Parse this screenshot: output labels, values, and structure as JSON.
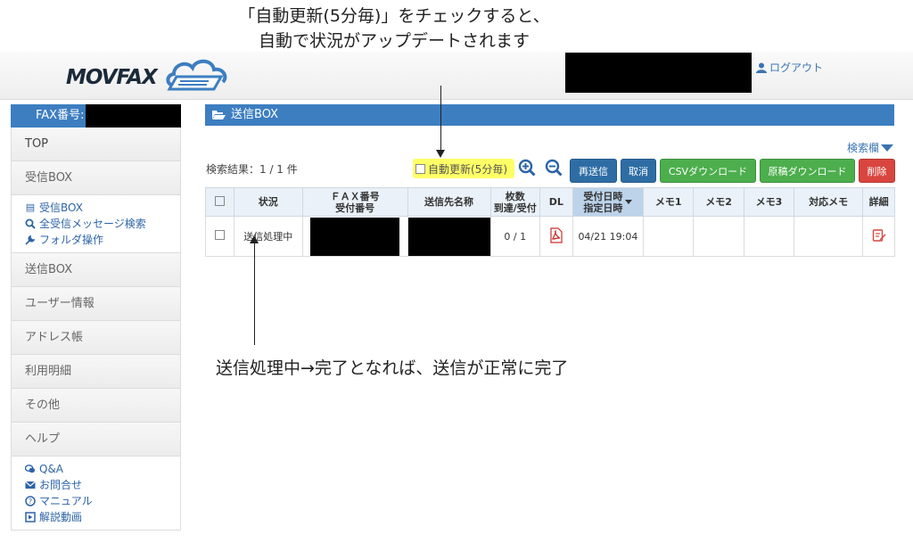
{
  "annotations": {
    "top_line1": "「自動更新(5分毎)」をチェックすると、",
    "top_line2": "自動で状況がアップデートされます",
    "mid": "送信処理中→完了となれば、送信が正常に完了"
  },
  "header": {
    "logo_text": "MOVFAX",
    "logout": "ログアウト"
  },
  "sidebar": {
    "fax_label": "FAX番号:",
    "items": [
      {
        "label": "TOP"
      },
      {
        "label": "受信BOX"
      },
      {
        "label": "送信BOX"
      },
      {
        "label": "ユーザー情報"
      },
      {
        "label": "アドレス帳"
      },
      {
        "label": "利用明細"
      },
      {
        "label": "その他"
      },
      {
        "label": "ヘルプ"
      }
    ],
    "inbox_sub": [
      {
        "label": "受信BOX",
        "icon": "inbox-icon"
      },
      {
        "label": "全受信メッセージ検索",
        "icon": "search-icon"
      },
      {
        "label": "フォルダ操作",
        "icon": "wrench-icon"
      }
    ],
    "help_sub": [
      {
        "label": "Q&A",
        "icon": "chat-icon"
      },
      {
        "label": "お問合せ",
        "icon": "envelope-icon"
      },
      {
        "label": "マニュアル",
        "icon": "question-icon"
      },
      {
        "label": "解説動画",
        "icon": "video-icon"
      }
    ]
  },
  "main": {
    "title": "送信BOX",
    "search_toggle": "検索欄",
    "result_count": "検索結果：1 / 1 件",
    "autorefresh_label": "自動更新(5分毎)",
    "buttons": {
      "resend": "再送信",
      "cancel": "取消",
      "csv": "CSVダウンロード",
      "original": "原稿ダウンロード",
      "delete": "削除"
    },
    "columns": {
      "status": "状況",
      "fax_number_1": "ＦＡＸ番号",
      "fax_number_2": "受付番号",
      "recipient": "送信先名称",
      "pages_1": "枚数",
      "pages_2": "到達/受付",
      "dl": "DL",
      "date_1": "受付日時",
      "date_2": "指定日時",
      "memo1": "メモ1",
      "memo2": "メモ2",
      "memo3": "メモ3",
      "response_memo": "対応メモ",
      "detail": "詳細"
    },
    "rows": [
      {
        "status": "送信処理中",
        "pages": "0 / 1",
        "datetime": "04/21 19:04"
      }
    ]
  },
  "colors": {
    "accent_blue": "#3d7ec1",
    "button_blue": "#2e6da4",
    "button_green": "#4cae4c",
    "button_red": "#d9453f",
    "highlight": "#ffff66"
  }
}
